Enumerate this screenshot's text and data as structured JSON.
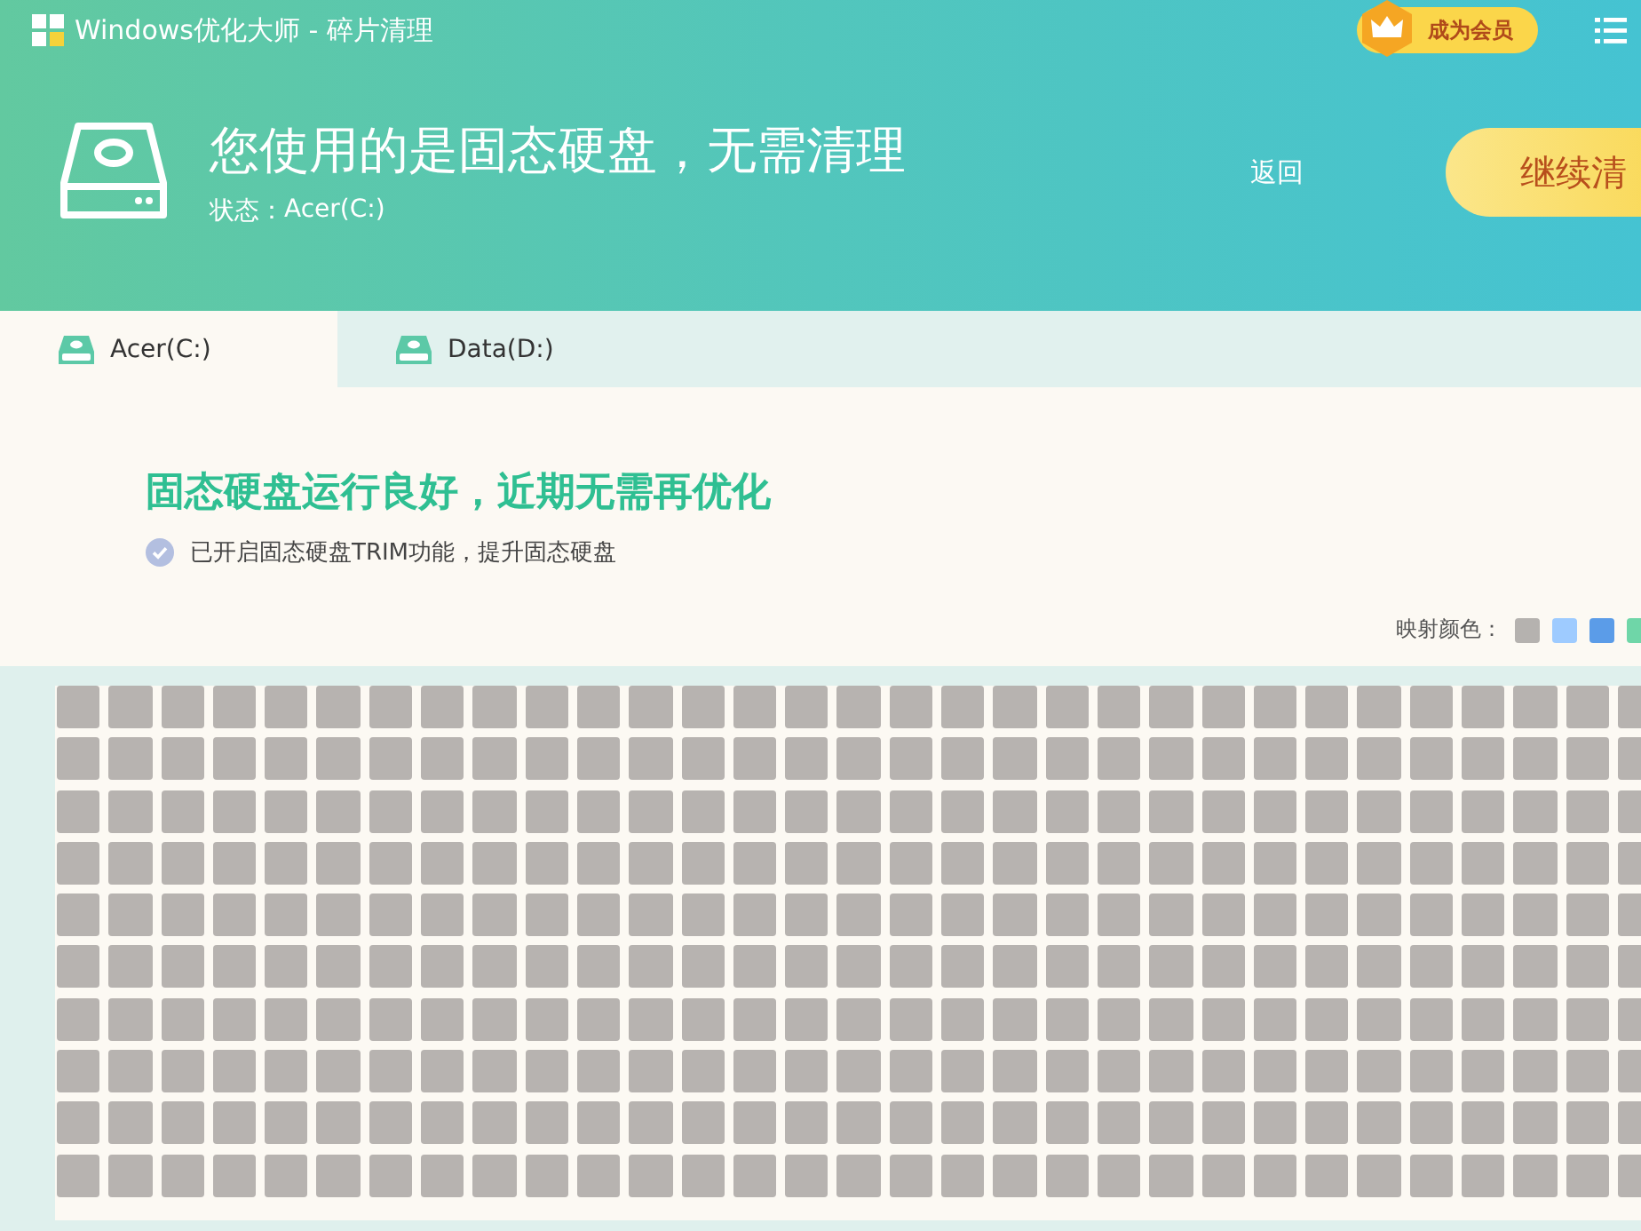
{
  "window": {
    "title": "Windows优化大师 - 碎片清理"
  },
  "vip_button": {
    "label": "成为会员"
  },
  "header": {
    "title": "您使用的是固态硬盘，无需清理",
    "status_label": "状态：",
    "status_value": "Acer(C:)",
    "back_link": "返回",
    "continue_button": "继续清"
  },
  "tabs": [
    {
      "label": "Acer(C:)",
      "selected": true
    },
    {
      "label": "Data(D:)",
      "selected": false
    }
  ],
  "result": {
    "headline": "固态硬盘运行良好，近期无需再优化",
    "note": "已开启固态硬盘TRIM功能，提升固态硬盘"
  },
  "legend": {
    "label": "映射颜色：",
    "swatches": [
      {
        "color": "#b5b2af"
      },
      {
        "color": "#9ecbff"
      },
      {
        "color": "#5b9ce8"
      },
      {
        "color": "#6fd6a8"
      }
    ]
  }
}
